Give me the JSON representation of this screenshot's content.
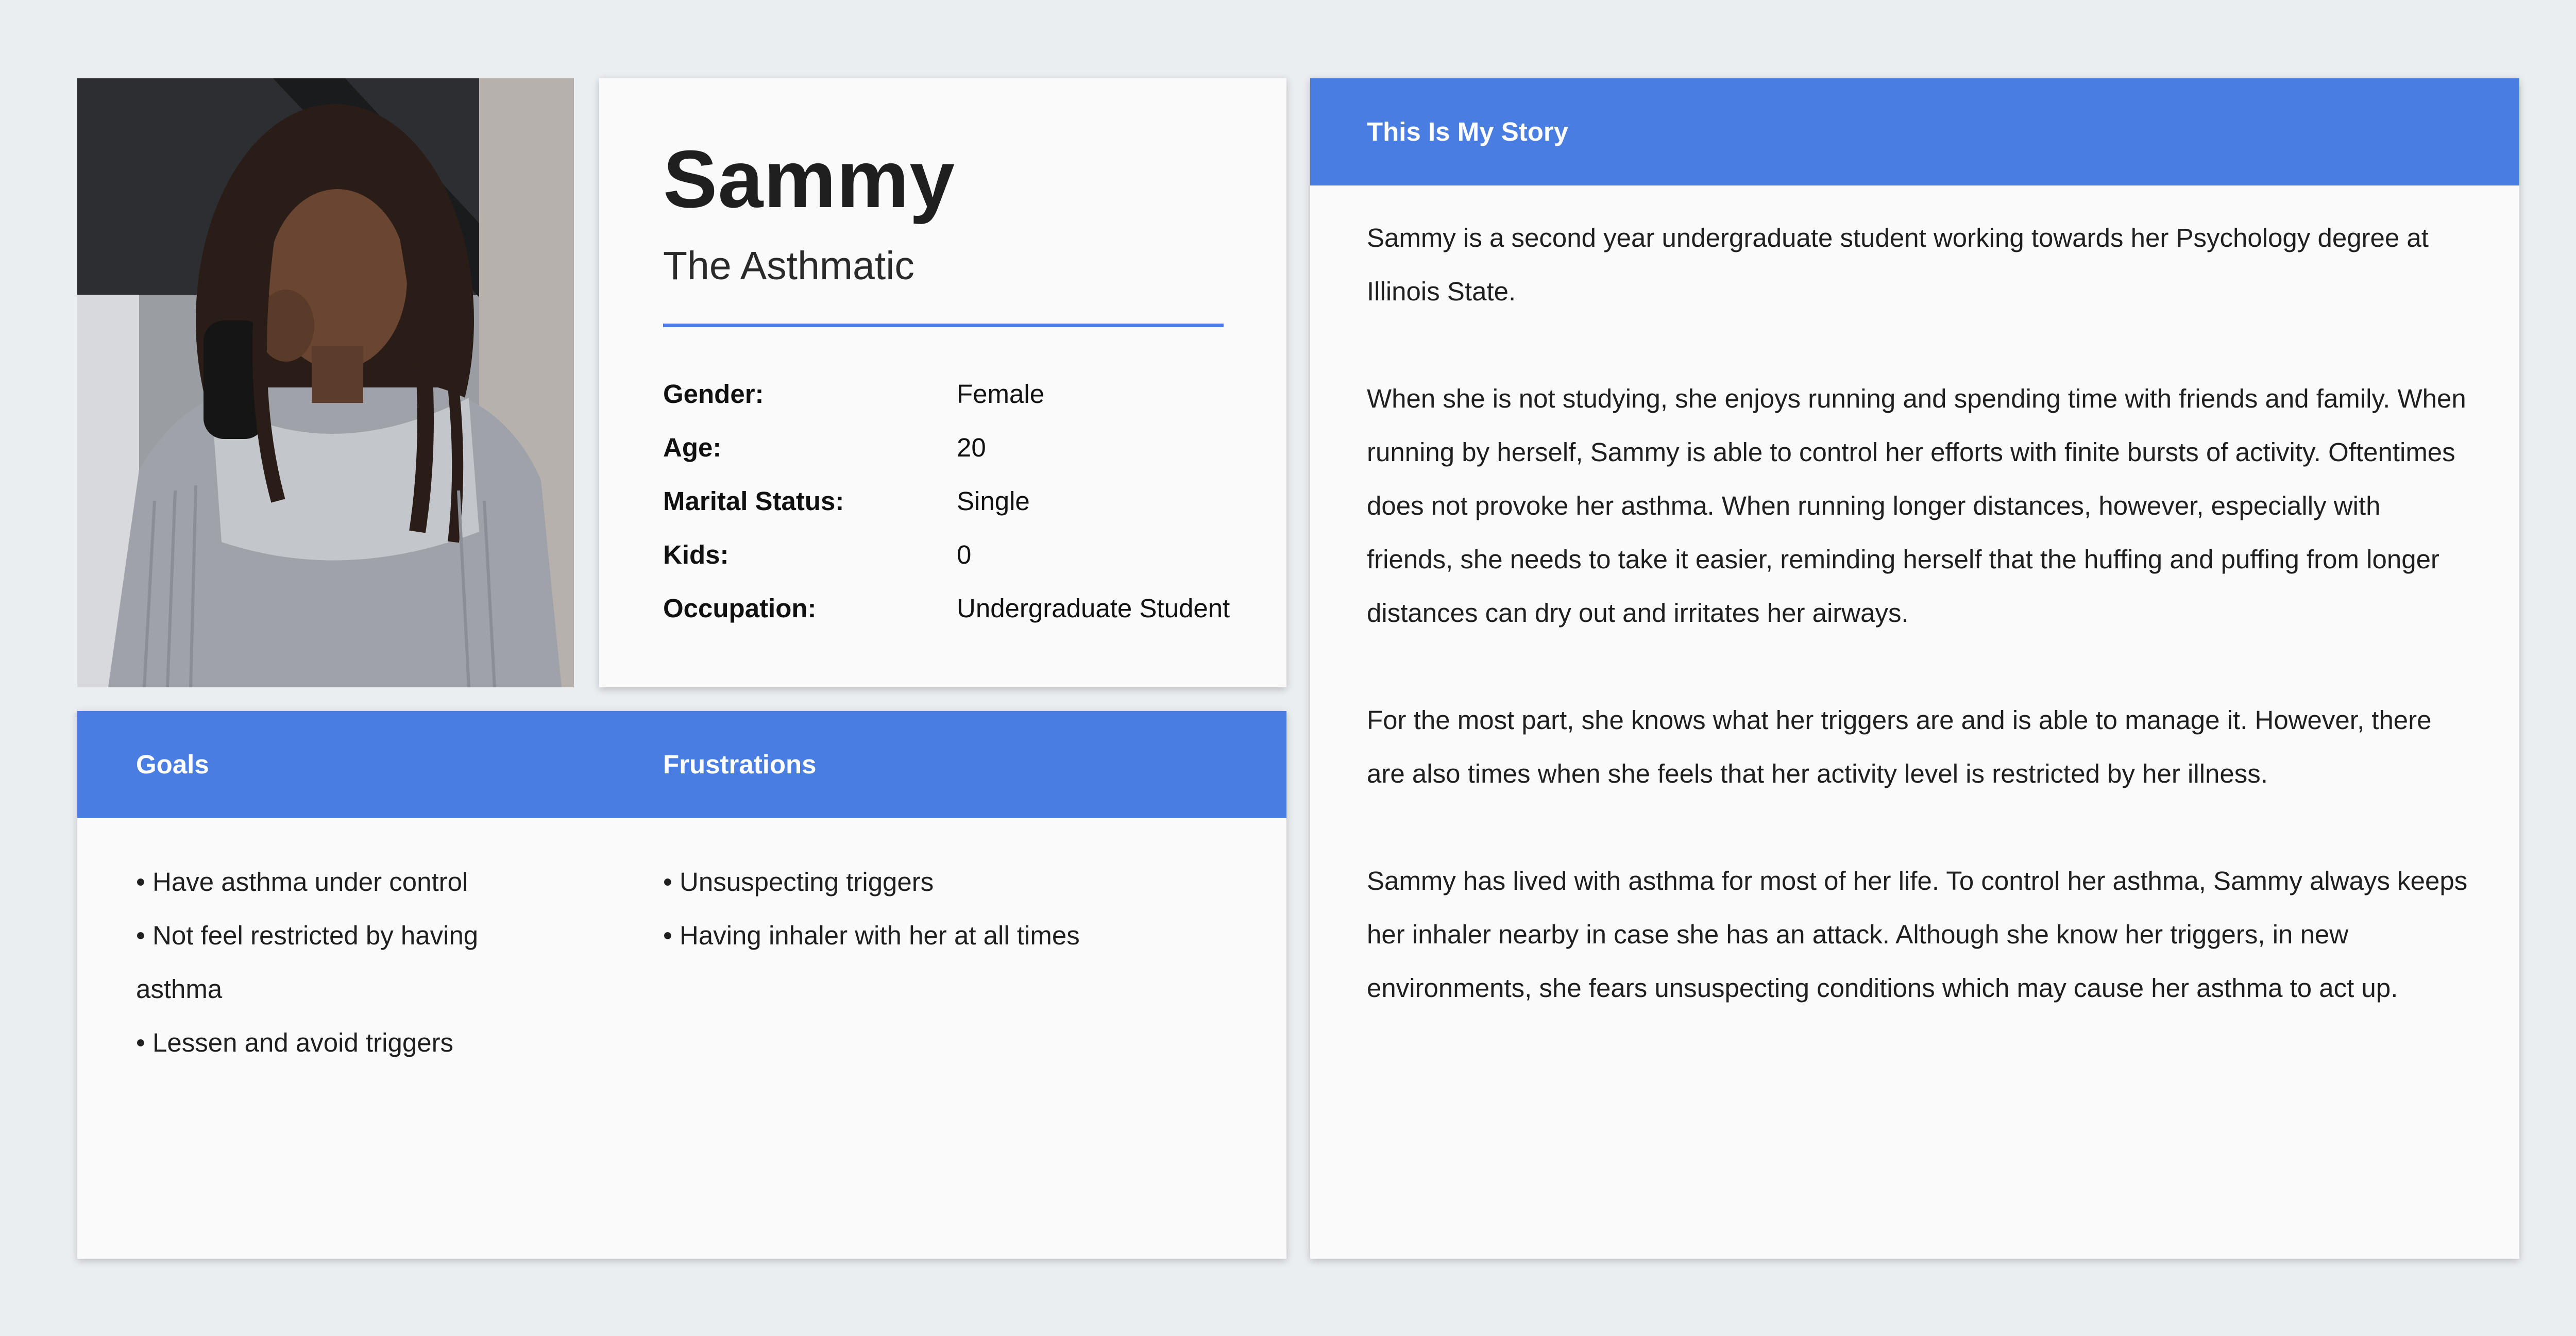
{
  "profile": {
    "name": "Sammy",
    "subtitle": "The Asthmatic",
    "facts": [
      {
        "label": "Gender:",
        "value": "Female"
      },
      {
        "label": "Age:",
        "value": "20"
      },
      {
        "label": "Marital Status:",
        "value": "Single"
      },
      {
        "label": "Kids:",
        "value": "0"
      },
      {
        "label": "Occupation:",
        "value": "Undergraduate Student"
      }
    ]
  },
  "goals": {
    "title": "Goals",
    "items": [
      "• Have asthma under control",
      "• Not feel restricted by having asthma",
      "• Lessen and avoid triggers"
    ]
  },
  "frustrations": {
    "title": "Frustrations",
    "items": [
      "• Unsuspecting triggers",
      "• Having inhaler with her at all times"
    ]
  },
  "story": {
    "title": "This Is My Story",
    "paragraphs": [
      "Sammy is a second year undergraduate student working towards her Psychology degree at Illinois State.",
      "When she is not studying, she enjoys running and spending time with friends and family. When running by herself, Sammy is able to control her efforts with finite bursts of activity. Oftentimes does not provoke her asthma. When running longer distances, however, especially with friends, she needs to take it easier, reminding herself that the huffing and puffing from longer distances can dry out and irritates her airways.",
      "For the most part, she knows what her triggers are and is able to manage it. However, there are also times when she feels that her activity level is restricted by her illness.",
      "Sammy has lived with asthma for most of her life. To control her asthma, Sammy always keeps her inhaler nearby in case she has an attack. Although she know her triggers, in new environments, she fears unsuspecting conditions which may cause her asthma to act up."
    ]
  },
  "colors": {
    "accent": "#4A7DE2",
    "background": "#EBEEF1",
    "card": "#FAFAFA"
  }
}
